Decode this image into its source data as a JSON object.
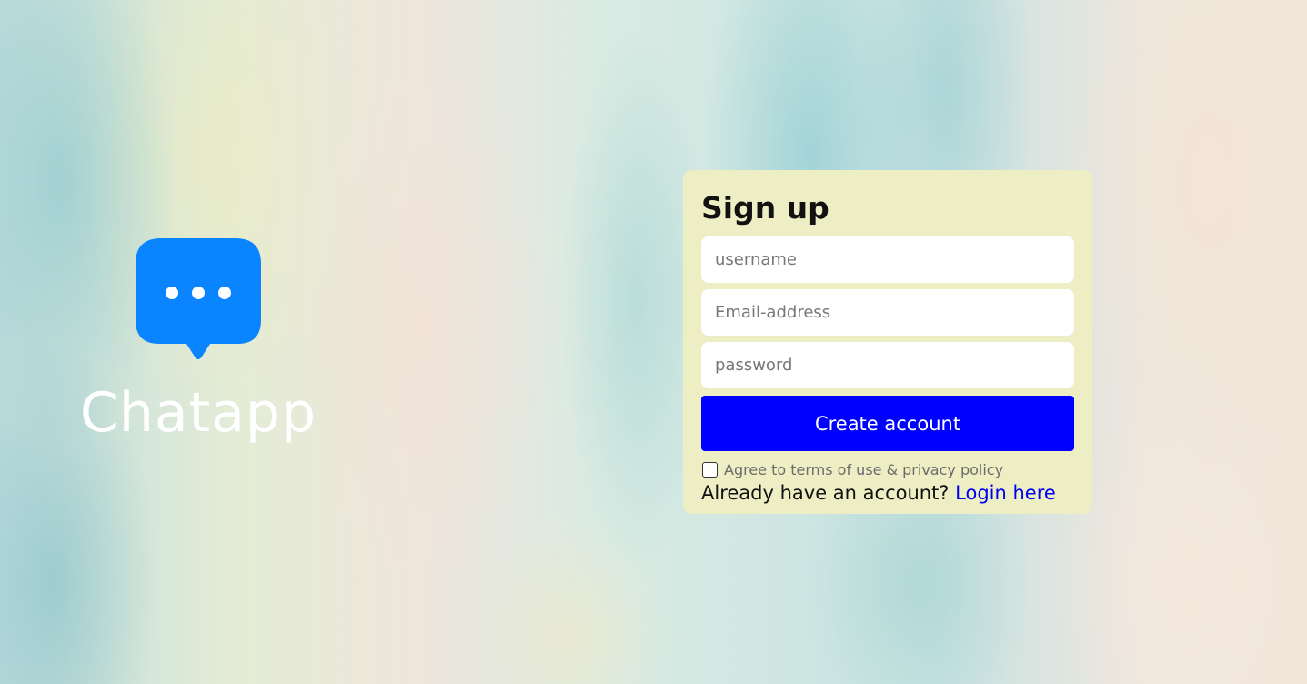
{
  "brand": {
    "name": "Chatapp",
    "icon": "chat-bubble-icon",
    "icon_color": "#0a84ff"
  },
  "signup": {
    "title": "Sign up",
    "username_placeholder": "username",
    "email_placeholder": "Email-address",
    "password_placeholder": "password",
    "submit_label": "Create account",
    "terms_label": "Agree to terms of use & privacy policy",
    "terms_checked": false,
    "login_prompt": "Already have an account?",
    "login_link": "Login here"
  },
  "colors": {
    "card_background": "#eeeec4",
    "button_background": "#0000ff",
    "link": "#0000ee"
  }
}
